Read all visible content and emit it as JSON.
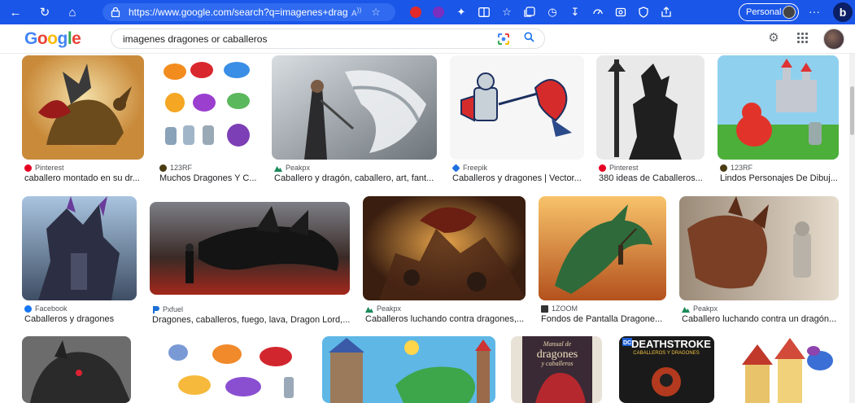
{
  "browser": {
    "url": "https://www.google.com/search?q=imagenes+drago...",
    "profile_label": "Personal",
    "more_label": "···",
    "copilot_label": "b",
    "read_aloud_label": "A",
    "accent": "#1a56e8"
  },
  "google": {
    "logo_letters": [
      "G",
      "o",
      "o",
      "g",
      "l",
      "e"
    ],
    "logo_colors": [
      "#4285F4",
      "#EA4335",
      "#FBBC05",
      "#4285F4",
      "#34A853",
      "#EA4335"
    ],
    "query": "imagenes dragones or caballeros"
  },
  "results": [
    {
      "source": "Pinterest",
      "icon": "pinterest",
      "caption": "caballero montado en su dr..."
    },
    {
      "source": "123RF",
      "icon": "123rf",
      "caption": "Muchos Dragones Y C..."
    },
    {
      "source": "Peakpx",
      "icon": "peakpx",
      "caption": "Caballero y dragón, caballero, art, fant..."
    },
    {
      "source": "Freepik",
      "icon": "freepik",
      "caption": "Caballeros y dragones | Vector..."
    },
    {
      "source": "Pinterest",
      "icon": "pinterest",
      "caption": "380 ideas de Caballeros..."
    },
    {
      "source": "123RF",
      "icon": "123rf",
      "caption": "Lindos Personajes De Dibuj..."
    },
    {
      "source": "Facebook",
      "icon": "facebook",
      "caption": "Caballeros y dragones"
    },
    {
      "source": "Pxfuel",
      "icon": "pxfuel",
      "caption": "Dragones, caballeros, fuego, lava, Dragon Lord,..."
    },
    {
      "source": "Peakpx",
      "icon": "peakpx",
      "caption": "Caballeros luchando contra dragones,..."
    },
    {
      "source": "1ZOOM",
      "icon": "1zoom",
      "caption": "Fondos de Pantalla Dragone..."
    },
    {
      "source": "Peakpx",
      "icon": "peakpx",
      "caption": "Caballero luchando contra un dragón..."
    },
    {
      "source": "",
      "icon": "",
      "caption": ""
    },
    {
      "source": "",
      "icon": "",
      "caption": ""
    },
    {
      "source": "",
      "icon": "",
      "caption": ""
    },
    {
      "source": "",
      "icon": "",
      "caption": ""
    },
    {
      "source": "",
      "icon": "",
      "caption": ""
    },
    {
      "source": "",
      "icon": "",
      "caption": ""
    }
  ],
  "book_covers": {
    "manual_title": "Manual de",
    "manual_dragones": "dragones",
    "manual_caballeros": "y caballeros",
    "deathstroke_title": "DEATHSTROKE",
    "deathstroke_sub": "CABALLEROS Y DRAGONES",
    "dc_label": "DC"
  }
}
